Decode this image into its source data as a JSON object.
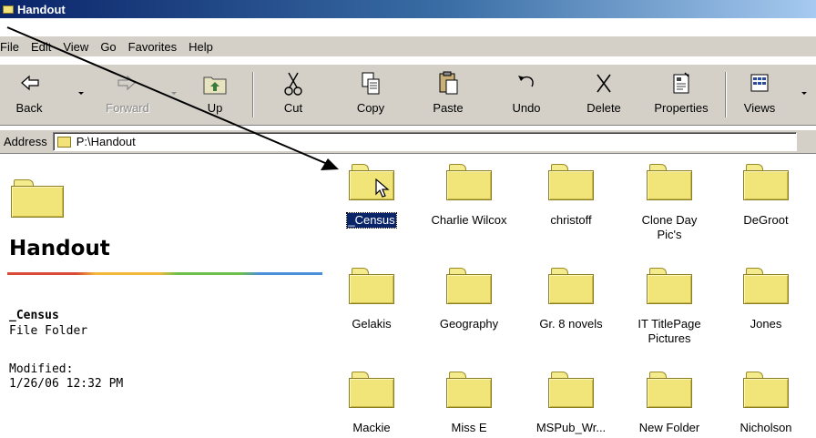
{
  "window": {
    "title": "Handout"
  },
  "menu": {
    "items": [
      {
        "label": "File"
      },
      {
        "label": "Edit"
      },
      {
        "label": "View"
      },
      {
        "label": "Go"
      },
      {
        "label": "Favorites"
      },
      {
        "label": "Help"
      }
    ]
  },
  "toolbar": {
    "back": "Back",
    "forward": "Forward",
    "up": "Up",
    "cut": "Cut",
    "copy": "Copy",
    "paste": "Paste",
    "undo": "Undo",
    "delete": "Delete",
    "properties": "Properties",
    "views": "Views"
  },
  "address": {
    "label": "Address",
    "value": "P:\\Handout"
  },
  "info_pane": {
    "title": "Handout",
    "selected_name": "_Census",
    "selected_type": "File Folder",
    "modified_label": "Modified:",
    "modified_value": "1/26/06 12:32 PM"
  },
  "folders": [
    {
      "name": "_Census",
      "selected": true
    },
    {
      "name": "Charlie Wilcox"
    },
    {
      "name": "christoff"
    },
    {
      "name": "Clone Day Pic's"
    },
    {
      "name": "DeGroot"
    },
    {
      "name": "Gelakis"
    },
    {
      "name": "Geography"
    },
    {
      "name": "Gr. 8 novels"
    },
    {
      "name": "IT TitlePage Pictures"
    },
    {
      "name": "Jones"
    },
    {
      "name": "Mackie"
    },
    {
      "name": "Miss E"
    },
    {
      "name": "MSPub_Wr..."
    },
    {
      "name": "New Folder"
    },
    {
      "name": "Nicholson"
    }
  ],
  "colors": {
    "titlebar": "#0a246a",
    "chrome": "#d4d0c8",
    "folder": "#f1e57a",
    "selection": "#0a246a"
  }
}
